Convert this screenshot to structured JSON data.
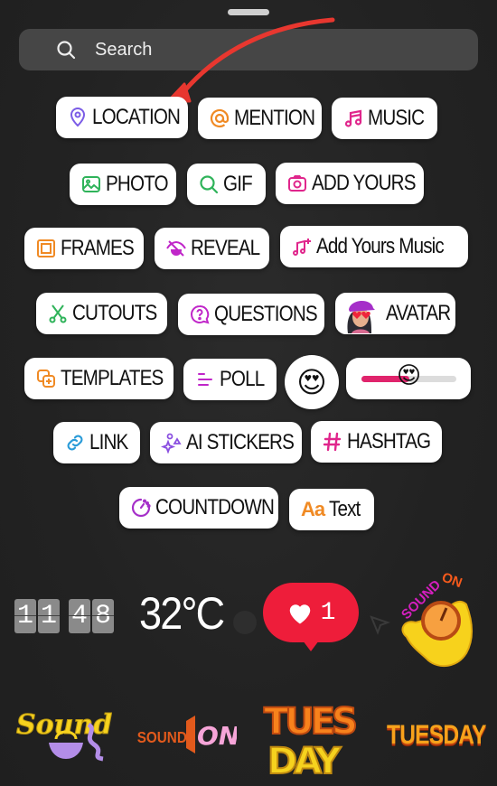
{
  "search": {
    "placeholder": "Search",
    "icon": "search-icon"
  },
  "annotation": {
    "type": "arrow",
    "color": "#e53935",
    "points_to": "LOCATION"
  },
  "stickers": [
    {
      "id": "location",
      "label": "LOCATION",
      "icon": "location-pin-icon",
      "color": "#7b5ce6"
    },
    {
      "id": "mention",
      "label": "MENTION",
      "icon": "at-sign-icon",
      "color": "#f08a24"
    },
    {
      "id": "music",
      "label": "MUSIC",
      "icon": "music-note-icon",
      "color": "#e0268c"
    },
    {
      "id": "photo",
      "label": "PHOTO",
      "icon": "image-icon",
      "color": "#2fb35a"
    },
    {
      "id": "gif",
      "label": "GIF",
      "icon": "search-icon",
      "color": "#2fb35a"
    },
    {
      "id": "add-yours",
      "label": "ADD YOURS",
      "icon": "camera-icon",
      "color": "#e0268c"
    },
    {
      "id": "frames",
      "label": "FRAMES",
      "icon": "frame-icon",
      "color": "#f08a24"
    },
    {
      "id": "reveal",
      "label": "REVEAL",
      "icon": "eye-off-icon",
      "color": "#c026c9"
    },
    {
      "id": "add-yours-music",
      "label": "Add Yours Music",
      "icon": "music-plus-icon",
      "color": "#e0268c"
    },
    {
      "id": "cutouts",
      "label": "CUTOUTS",
      "icon": "scissors-icon",
      "color": "#2fb35a"
    },
    {
      "id": "questions",
      "label": "QUESTIONS",
      "icon": "question-bubble-icon",
      "color": "#c026c9"
    },
    {
      "id": "avatar",
      "label": "AVATAR",
      "icon": "avatar-icon",
      "color": "#a52fc9"
    },
    {
      "id": "templates",
      "label": "TEMPLATES",
      "icon": "templates-icon",
      "color": "#f08a24"
    },
    {
      "id": "poll",
      "label": "POLL",
      "icon": "poll-icon",
      "color": "#c026c9"
    },
    {
      "id": "link",
      "label": "LINK",
      "icon": "link-icon",
      "color": "#2a9bd8"
    },
    {
      "id": "ai-stickers",
      "label": "AI STICKERS",
      "icon": "sparkle-shapes-icon",
      "color": "#8a4fe0"
    },
    {
      "id": "hashtag",
      "label": "HASHTAG",
      "icon": "hashtag-icon",
      "color": "#e0268c"
    },
    {
      "id": "countdown",
      "label": "COUNTDOWN",
      "icon": "timer-icon",
      "color": "#a52fc9"
    },
    {
      "id": "text",
      "label": "Text",
      "icon": "Aa",
      "color": "#f08a24"
    }
  ],
  "emoji_sticker": {
    "emoji": "😍"
  },
  "slider_sticker": {
    "emoji": "😍",
    "value": 0.5,
    "fill_color": "#e0246c"
  },
  "clock_sticker": {
    "digits": [
      "1",
      "1",
      "4",
      "8"
    ]
  },
  "temperature_sticker": {
    "text": "32°C"
  },
  "like_sticker": {
    "count": "1",
    "color": "#ee1d3a"
  },
  "sound_on_sticker": {
    "text": "SOUND ON"
  },
  "bottom_stickers": [
    {
      "id": "sound-bowl",
      "text": "Sound"
    },
    {
      "id": "sound-on-speaker",
      "text_left": "SOUND",
      "text_right": "ON!"
    },
    {
      "id": "tues-day-graffiti",
      "line1": "TUES",
      "line2": "DAY"
    },
    {
      "id": "tuesday-text",
      "text": "TUESDAY"
    }
  ]
}
